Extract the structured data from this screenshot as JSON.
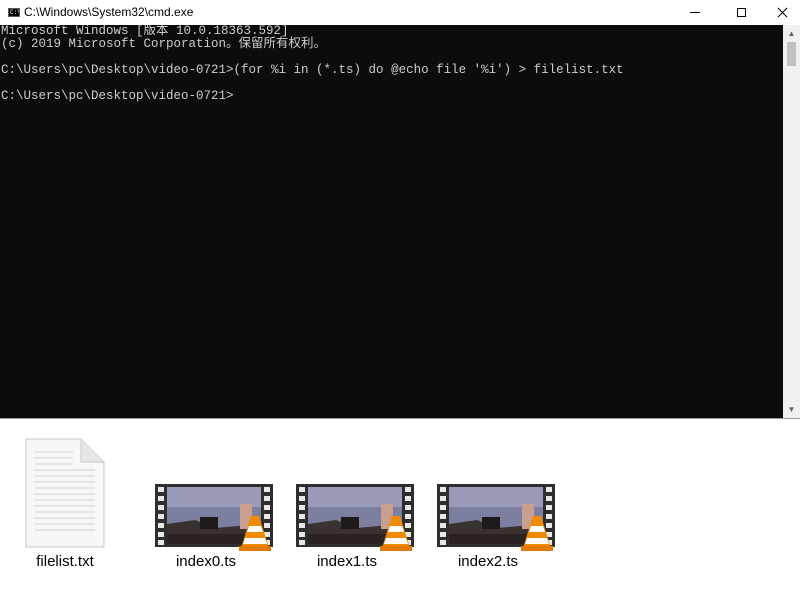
{
  "window": {
    "title": "C:\\Windows\\System32\\cmd.exe",
    "icon_text": "C:\\",
    "minimize_label": "Minimize",
    "maximize_label": "Maximize",
    "close_label": "Close"
  },
  "console": {
    "lines": [
      "Microsoft Windows [版本 10.0.18363.592]",
      "(c) 2019 Microsoft Corporation。保留所有权利。",
      "",
      "C:\\Users\\pc\\Desktop\\video-0721>(for %i in (*.ts) do @echo file '%i') > filelist.txt",
      "",
      "C:\\Users\\pc\\Desktop\\video-0721>"
    ],
    "background": "#0c0c0c",
    "foreground": "#cccccc"
  },
  "files": [
    {
      "name": "filelist.txt",
      "icon": "text-document-icon"
    },
    {
      "name": "index0.ts",
      "icon": "video-file-icon"
    },
    {
      "name": "index1.ts",
      "icon": "video-file-icon"
    },
    {
      "name": "index2.ts",
      "icon": "video-file-icon"
    }
  ]
}
